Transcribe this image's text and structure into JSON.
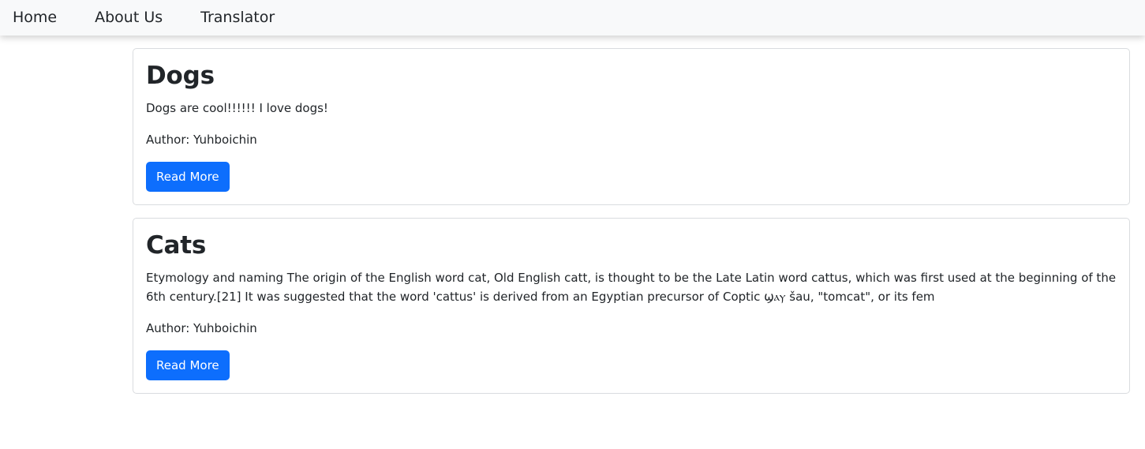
{
  "nav": {
    "items": [
      {
        "label": "Home"
      },
      {
        "label": "About Us"
      },
      {
        "label": "Translator"
      }
    ]
  },
  "posts": [
    {
      "title": "Dogs",
      "body": "Dogs are cool!!!!!! I love dogs!",
      "author": "Author: Yuhboichin",
      "button_label": "Read More"
    },
    {
      "title": "Cats",
      "body": "Etymology and naming The origin of the English word cat, Old English catt, is thought to be the Late Latin word cattus, which was first used at the beginning of the 6th century.[21] It was suggested that the word 'cattus' is derived from an Egyptian precursor of Coptic ϣⲁⲩ šau, \"tomcat\", or its fem",
      "author": "Author: Yuhboichin",
      "button_label": "Read More"
    }
  ],
  "colors": {
    "primary": "#0d6efd",
    "navbar_bg": "#f8f9fa",
    "text": "#212529",
    "card_border": "#d9dcdf"
  }
}
